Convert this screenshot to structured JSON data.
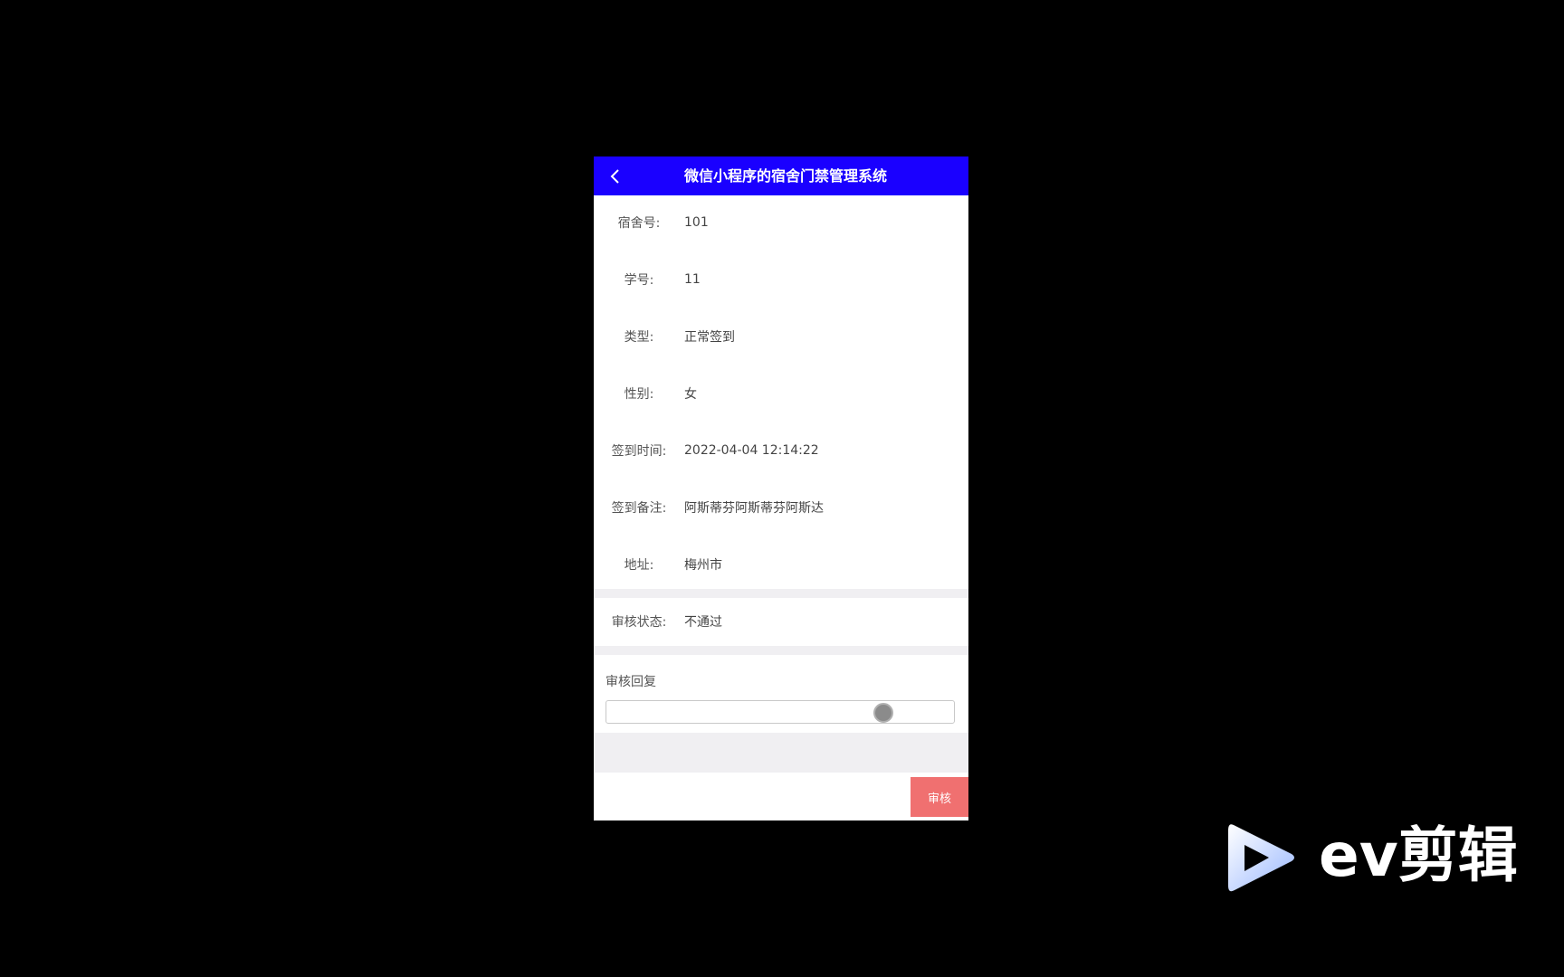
{
  "header": {
    "title": "微信小程序的宿舍门禁管理系统",
    "back_icon": "chevron-left-icon"
  },
  "fields": [
    {
      "label": "宿舍号:",
      "value": "101"
    },
    {
      "label": "学号:",
      "value": "11"
    },
    {
      "label": "类型:",
      "value": "正常签到"
    },
    {
      "label": "性别:",
      "value": "女"
    },
    {
      "label": "签到时间:",
      "value": "2022-04-04 12:14:22"
    },
    {
      "label": "签到备注:",
      "value": "阿斯蒂芬阿斯蒂芬阿斯达"
    },
    {
      "label": "地址:",
      "value": "梅州市"
    }
  ],
  "review": {
    "status_label": "审核状态:",
    "status_value": "不通过",
    "reply_label": "审核回复",
    "reply_value": "",
    "submit_label": "审核"
  },
  "watermark": {
    "text": "ev剪辑"
  },
  "colors": {
    "nav_bg": "#1a00ff",
    "submit_bg": "#f07070",
    "page_bg": "#000000"
  }
}
